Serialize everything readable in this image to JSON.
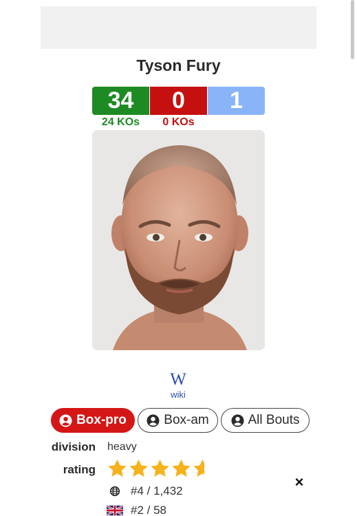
{
  "boxer": {
    "name": "Tyson Fury",
    "record": {
      "wins": "34",
      "losses": "0",
      "draws": "1"
    },
    "kos": {
      "wins": "24 KOs",
      "losses": "0 KOs"
    }
  },
  "wiki": {
    "icon": "W",
    "label": "wiki"
  },
  "tabs": [
    {
      "label": "Box-pro",
      "active": true
    },
    {
      "label": "Box-am",
      "active": false
    },
    {
      "label": "All Bouts",
      "active": false
    }
  ],
  "details": {
    "division_label": "division",
    "division_value": "heavy",
    "rating_label": "rating",
    "rating_stars": 4.5,
    "world_rank": "#4 / 1,432",
    "uk_rank": "#2 / 58"
  },
  "close_icon": "×",
  "colors": {
    "win": "#1e8a23",
    "loss": "#c61010",
    "draw": "#8ab4f8",
    "star": "#f6b21c",
    "active_tab": "#d41616"
  }
}
